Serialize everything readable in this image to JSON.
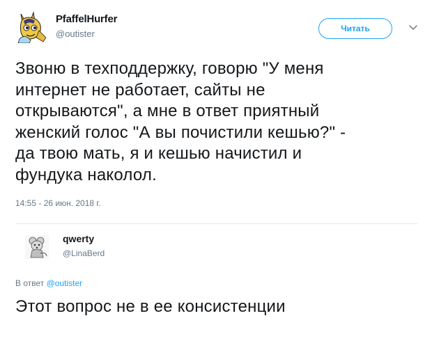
{
  "tweet": {
    "author_name": "PfaffelHurfer",
    "author_handle": "@outister",
    "follow_label": "Читать",
    "text": "Звоню в техподдержку, говорю \"У меня\nинтернет не работает, сайты не\nоткрываются\", а мне в ответ приятный\nженский голос \"А вы почистили кешью?\" -\nда твою мать, я и кешью начистил и\nфундука наколол.",
    "timestamp": "14:55 - 26 июн. 2018 г."
  },
  "reply": {
    "author_name": "qwerty",
    "author_handle": "@LinaBerd",
    "replying_label": "В ответ",
    "replying_to": "@outister",
    "text": "Этот вопрос не в ее консистенции"
  },
  "colors": {
    "accent": "#1da1f2",
    "muted_text": "#657786",
    "divider": "#e6ecf0"
  },
  "icons": {
    "tweet_avatar": "cartoon-pony-avatar",
    "reply_avatar": "mouse-figurine-avatar",
    "menu": "chevron-down-icon"
  }
}
